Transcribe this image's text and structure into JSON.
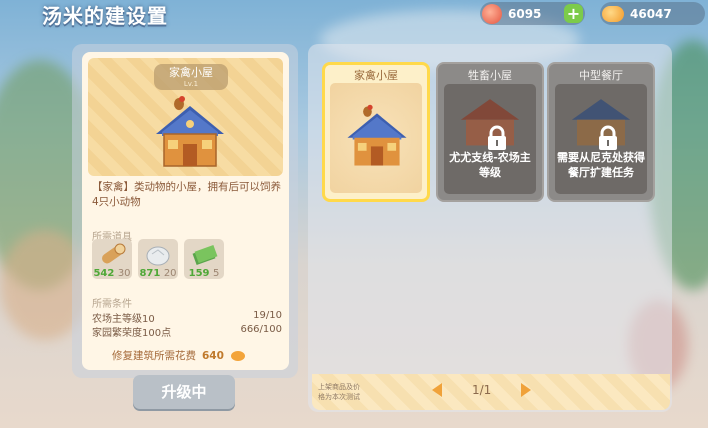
{
  "title": "汤米的建设置",
  "resources": {
    "peach": "6095",
    "coin": "46047"
  },
  "detail": {
    "name": "家禽小屋",
    "level": "Lv.1",
    "description": "【家禽】类动物的小屋，拥有后可以饲养4只小动物",
    "materials_label": "所需道具",
    "materials": [
      {
        "icon": "wood-log-icon",
        "have": "542",
        "need": "30"
      },
      {
        "icon": "stone-icon",
        "have": "871",
        "need": "20"
      },
      {
        "icon": "cash-icon",
        "have": "159",
        "need": "5"
      }
    ],
    "conditions_label": "所需条件",
    "conditions": [
      {
        "label": "农场主等级10",
        "value": "19/10"
      },
      {
        "label": "家园繁荣度100点",
        "value": "666/100"
      }
    ],
    "cost_label": "修复建筑所需花费",
    "cost_value": "640",
    "upgrade_button": "升级中"
  },
  "buildings": [
    {
      "name": "家禽小屋",
      "locked": false
    },
    {
      "name": "牲畜小屋",
      "locked": true,
      "hint": "尤尤支线-农场主等级"
    },
    {
      "name": "中型餐厅",
      "locked": true,
      "hint": "需要从尼克处获得餐厅扩建任务"
    }
  ],
  "footer": {
    "note_line1": "上架商品及价",
    "note_line2": "格为本次测试",
    "page": "1/1"
  },
  "colors": {
    "selected_border": "#ffd94a",
    "have_green": "#4fa837",
    "accent_orange": "#f0a23a"
  }
}
